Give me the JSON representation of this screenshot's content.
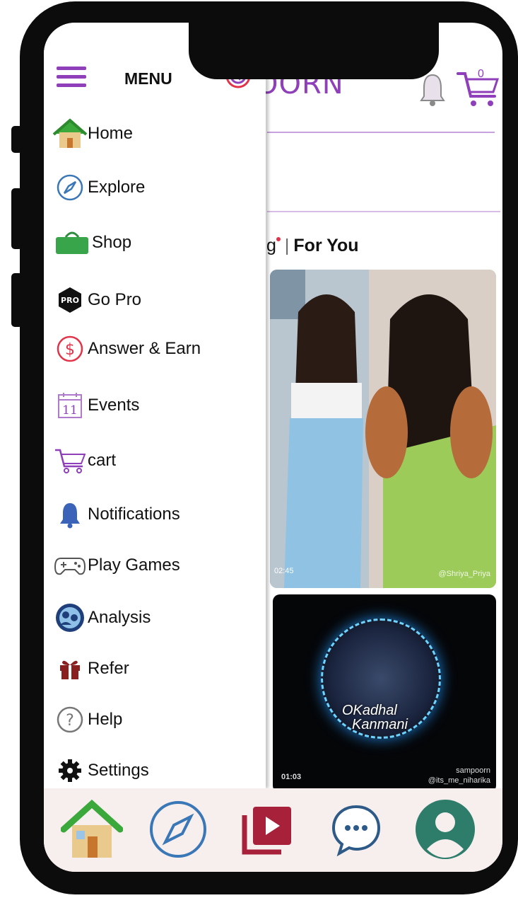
{
  "drawer": {
    "title": "MENU",
    "items": [
      {
        "label": "Home",
        "icon": "home-icon"
      },
      {
        "label": "Explore",
        "icon": "compass-icon"
      },
      {
        "label": "Shop",
        "icon": "shopping-bag-icon"
      },
      {
        "label": "Go Pro",
        "icon": "pro-badge-icon"
      },
      {
        "label": "Answer & Earn",
        "icon": "dollar-icon"
      },
      {
        "label": "Events",
        "icon": "calendar-icon"
      },
      {
        "label": "cart",
        "icon": "cart-icon"
      },
      {
        "label": "Notifications",
        "icon": "bell-icon"
      },
      {
        "label": "Play Games",
        "icon": "gamepad-icon"
      },
      {
        "label": "Analysis",
        "icon": "analysis-icon"
      },
      {
        "label": "Refer",
        "icon": "gift-icon"
      },
      {
        "label": "Help",
        "icon": "help-icon"
      },
      {
        "label": "Settings",
        "icon": "gear-icon"
      }
    ],
    "pro_badge_text": "PRO",
    "calendar_day": "11"
  },
  "header": {
    "brand_partial": "OORN",
    "cart_count": "0"
  },
  "feed": {
    "tab_partial": "g",
    "tab_active": "For You",
    "tiles": [
      {
        "time": "02:45",
        "user": "@Shriya_Priya"
      },
      {
        "time": "01:03",
        "song_line1": "OKadhal",
        "song_line2": "Kanmani",
        "brand": "sampoorn",
        "user": "@its_me_niharika"
      }
    ]
  },
  "colors": {
    "accent": "#8e3fb9",
    "frame": "#0c0c0c",
    "nav_bg": "#f7eeee"
  }
}
